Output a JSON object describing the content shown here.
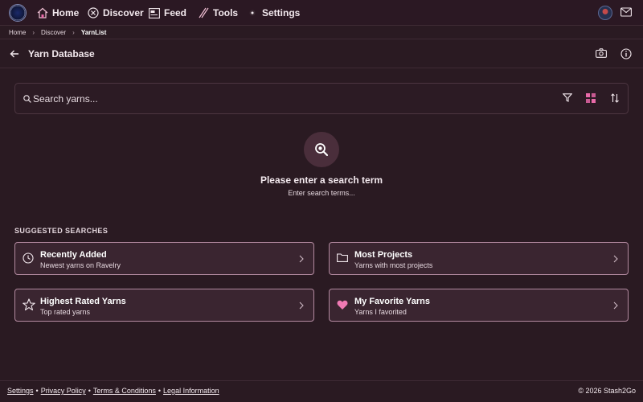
{
  "nav": {
    "items": [
      {
        "label": "Home",
        "icon": "home-icon"
      },
      {
        "label": "Discover",
        "icon": "compass-icon"
      },
      {
        "label": "Feed",
        "icon": "feed-icon"
      },
      {
        "label": "Tools",
        "icon": "needles-icon"
      },
      {
        "label": "Settings",
        "icon": "gear-icon"
      }
    ]
  },
  "breadcrumb": [
    "Home",
    "Discover",
    "YarnList"
  ],
  "page": {
    "title": "Yarn Database"
  },
  "search": {
    "placeholder": "Search yarns...",
    "value": ""
  },
  "empty_state": {
    "title": "Please enter a search term",
    "subtitle": "Enter search terms..."
  },
  "suggested": {
    "label": "SUGGESTED SEARCHES",
    "items": [
      {
        "title": "Recently Added",
        "subtitle": "Newest yarns on Ravelry",
        "icon": "clock-icon"
      },
      {
        "title": "Most Projects",
        "subtitle": "Yarns with most projects",
        "icon": "folder-icon"
      },
      {
        "title": "Highest Rated Yarns",
        "subtitle": "Top rated yarns",
        "icon": "star-icon"
      },
      {
        "title": "My Favorite Yarns",
        "subtitle": "Yarns I favorited",
        "icon": "heart-icon"
      }
    ]
  },
  "footer": {
    "links": [
      "Settings",
      "Privacy Policy",
      "Terms & Conditions",
      "Legal Information"
    ],
    "copyright": "© 2026 Stash2Go"
  },
  "colors": {
    "background": "#2a1a22",
    "card_background": "#3a2530",
    "card_border": "#b38aa0",
    "accent_pink": "#e86aa8"
  }
}
